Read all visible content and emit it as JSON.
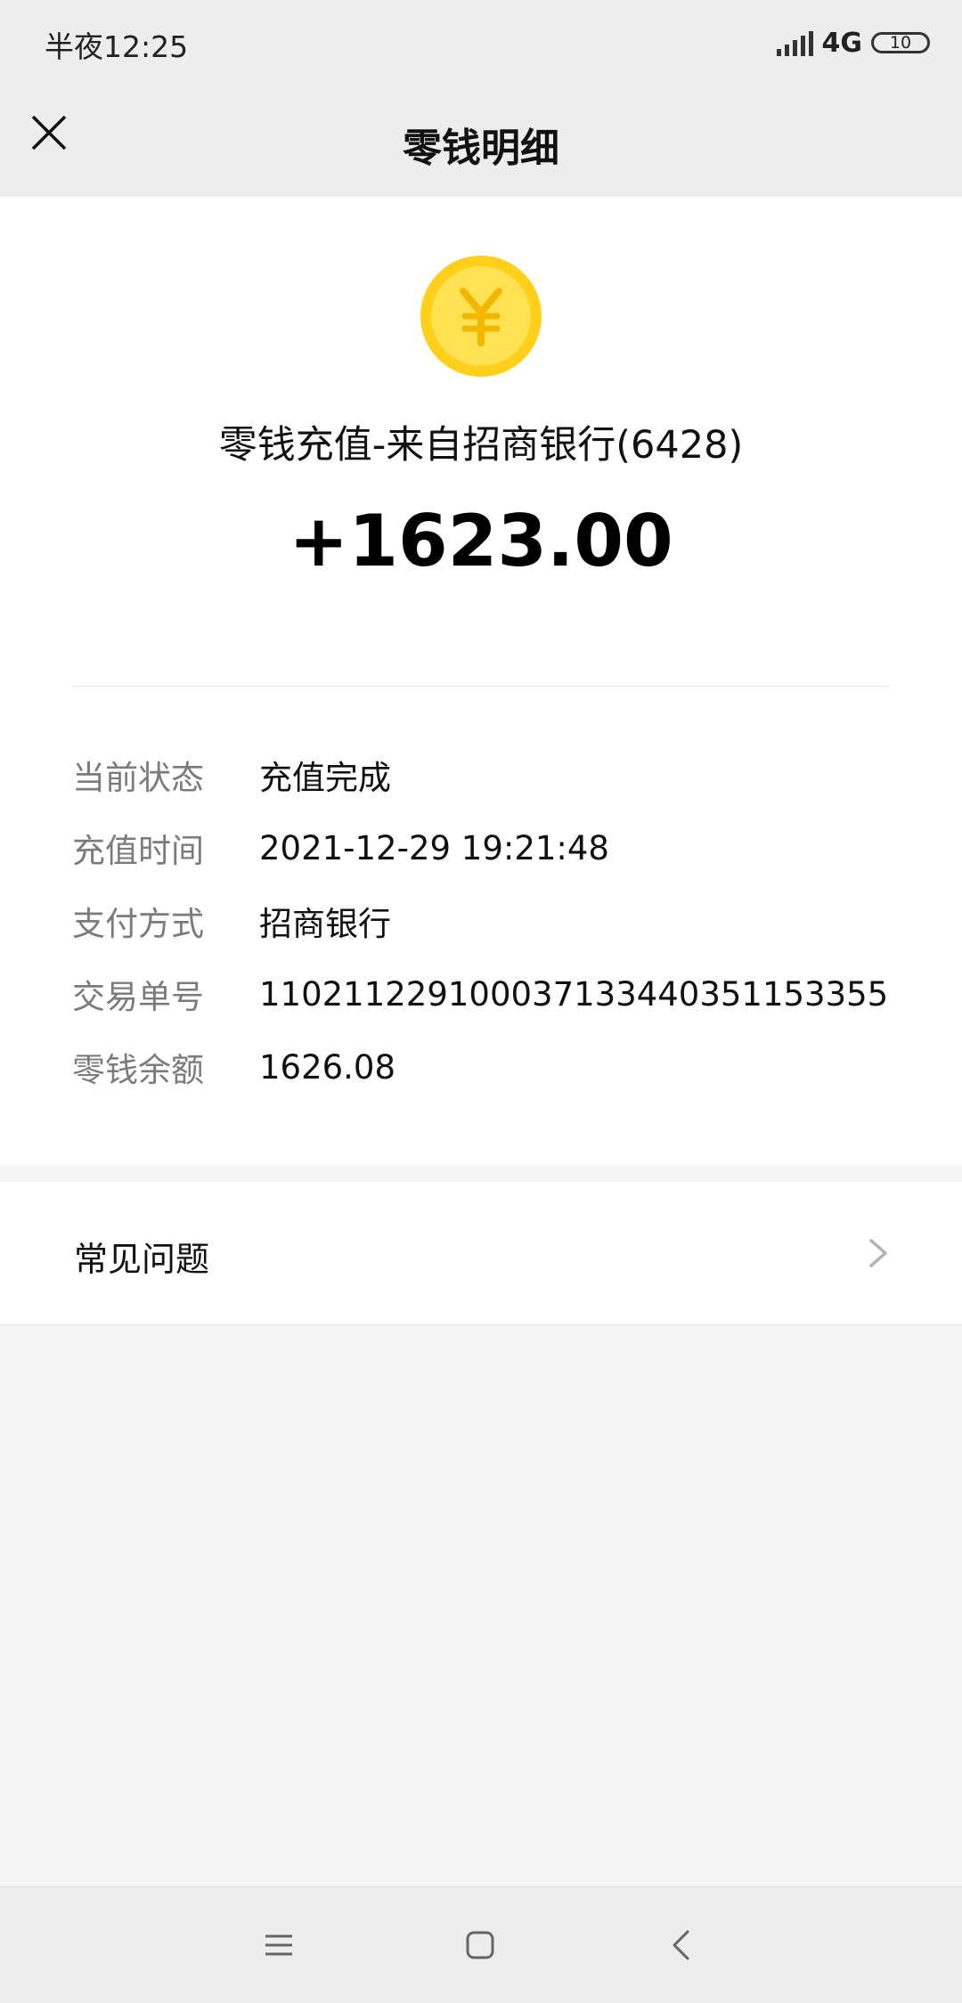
{
  "status_bar": {
    "time": "半夜12:25",
    "network": "4G",
    "battery": "10"
  },
  "header": {
    "title": "零钱明细",
    "close_icon": "close-icon"
  },
  "transaction": {
    "icon": "yuan-coin-icon",
    "title": "零钱充值-来自招商银行(6428)",
    "amount": "+1623.00",
    "details": [
      {
        "label": "当前状态",
        "value": "充值完成"
      },
      {
        "label": "充值时间",
        "value": "2021-12-29 19:21:48"
      },
      {
        "label": "支付方式",
        "value": "招商银行"
      },
      {
        "label": "交易单号",
        "value": "110211229100037133440351153355"
      },
      {
        "label": "零钱余额",
        "value": "1626.08"
      }
    ]
  },
  "faq": {
    "label": "常见问题",
    "arrow_icon": "chevron-right-icon"
  },
  "nav_bar": {
    "icons": [
      "menu-icon",
      "home-icon",
      "back-icon"
    ]
  },
  "colors": {
    "header_bg": "#ededed",
    "coin": "#ffd21f",
    "label_gray": "#7b7b7b"
  }
}
